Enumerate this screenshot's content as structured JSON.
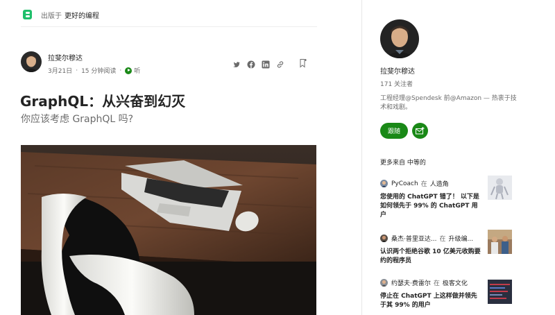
{
  "publication": {
    "prefix": "出版于",
    "name": "更好的编程",
    "icon": "publication-logo-icon"
  },
  "article": {
    "author": "拉斐尔穆达",
    "date": "3月21日",
    "read_time": "15 分钟阅读",
    "separator": "·",
    "listen_label": "听",
    "title": "GraphQL：从兴奋到幻灭",
    "subtitle": "你应该考虑 GraphQL 吗?",
    "share_icons": [
      "twitter-icon",
      "facebook-icon",
      "linkedin-icon",
      "link-icon"
    ],
    "bookmark_icon": "bookmark-icon"
  },
  "sidebar": {
    "name": "拉斐尔穆达",
    "followers": "171 关注者",
    "bio": "工程经理@Spendesk 前@Amazon — 热衷于技术和戏剧。",
    "follow_label": "跟随",
    "subscribe_icon": "mail-plus-icon",
    "more_heading": "更多来自 中等的",
    "recommendations": [
      {
        "author": "PyCoach",
        "in": "在",
        "publication": "人造角",
        "title": "您使用的 ChatGPT 错了！ 以下是如何领先于 99% 的 ChatGPT 用户"
      },
      {
        "author": "桑杰·普里亚达...",
        "in": "在",
        "publication": "升级编...",
        "title": "认识两个拒绝谷歌 10 亿美元收购要约的程序员"
      },
      {
        "author": "约瑟夫·费雷尔",
        "in": "在",
        "publication": "极客文化",
        "title": "停止在 ChatGPT 上这样做并领先于其 99% 的用户"
      }
    ]
  },
  "colors": {
    "accent": "#1a8917",
    "brand": "#1fbf6b",
    "text": "#242424",
    "muted": "#6b6b6b"
  }
}
